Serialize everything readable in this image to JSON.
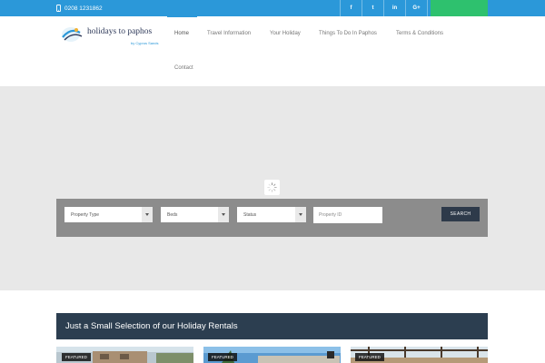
{
  "topbar": {
    "phone": "0208 1231862",
    "social": [
      {
        "icon": "facebook-icon",
        "glyph": "f"
      },
      {
        "icon": "twitter-icon",
        "glyph": "t"
      },
      {
        "icon": "linkedin-icon",
        "glyph": "in"
      },
      {
        "icon": "google-plus-icon",
        "glyph": "G+"
      },
      {
        "icon": "instagram-icon",
        "glyph": "◎"
      }
    ]
  },
  "logo": {
    "title": "holidays to paphos",
    "subtitle": "by Cyprus Sands"
  },
  "nav": {
    "items": [
      "Home",
      "Travel Information",
      "Your Holiday",
      "Things To Do In Paphos",
      "Terms & Conditions",
      "Contact"
    ]
  },
  "search": {
    "property_type": "Property Type",
    "beds": "Beds",
    "status": "Status",
    "property_id_placeholder": "Property ID",
    "button": "SEARCH"
  },
  "section": {
    "title": "Just a Small Selection of our Holiday Rentals"
  },
  "cards": [
    {
      "badge": "FEATURED"
    },
    {
      "badge": "FEATURED"
    },
    {
      "badge": "FEATURED"
    }
  ],
  "colors": {
    "accent": "#2b98d9",
    "green": "#2ec16e",
    "dark": "#2c3e50"
  }
}
